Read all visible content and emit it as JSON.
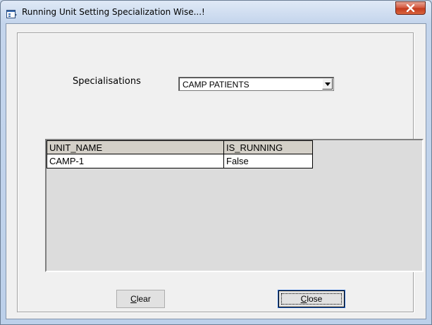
{
  "window": {
    "title": "Running Unit Setting Specialization Wise...!"
  },
  "form": {
    "specialisations_label": "Specialisations",
    "specialisations_value": "CAMP PATIENTS"
  },
  "grid": {
    "columns": [
      "UNIT_NAME",
      "IS_RUNNING"
    ],
    "rows": [
      [
        "CAMP-1",
        "False"
      ]
    ]
  },
  "buttons": {
    "clear_accel": "C",
    "clear_rest": "lear",
    "close_accel": "C",
    "close_rest": "lose"
  }
}
